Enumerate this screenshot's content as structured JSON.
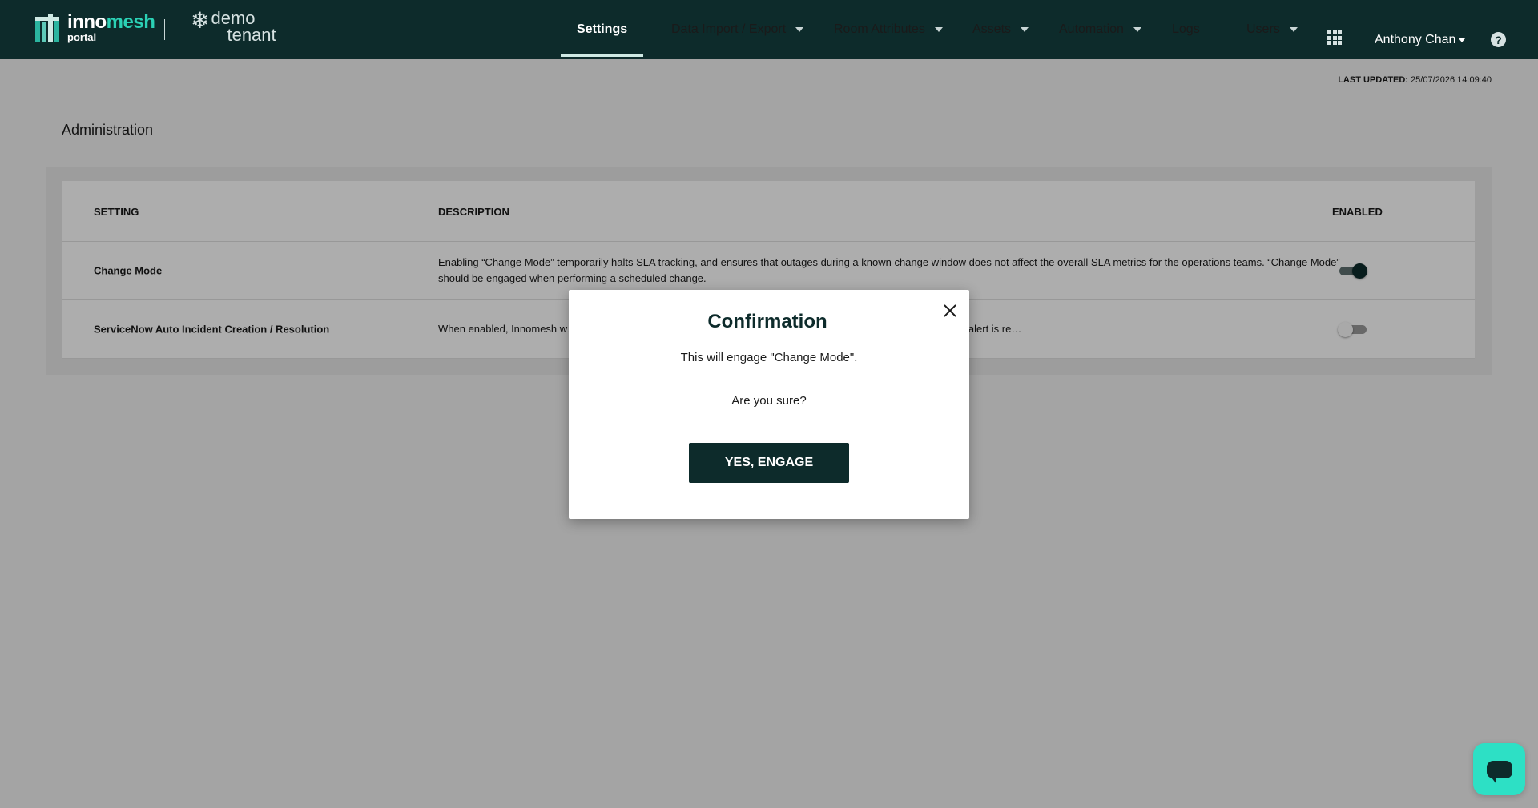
{
  "brand": {
    "name_part1": "inno",
    "name_part2": "mesh",
    "sub": "portal",
    "tenant_line1": "demo",
    "tenant_line2": "tenant"
  },
  "nav": {
    "items": [
      {
        "label": "Settings",
        "active": true
      },
      {
        "label": "Data Import / Export",
        "dropdown": true
      },
      {
        "label": "Room Attributes",
        "dropdown": true
      },
      {
        "label": "Assets",
        "dropdown": true
      },
      {
        "label": "Automation",
        "dropdown": true
      },
      {
        "label": "Logs"
      },
      {
        "label": "Users",
        "dropdown": true
      }
    ],
    "user": "Anthony Chan",
    "help": "?"
  },
  "status": {
    "last_updated_label": "LAST UPDATED",
    "last_updated_value": "25/07/2026 14:09:40"
  },
  "page": {
    "title": "Administration"
  },
  "table": {
    "headers": {
      "setting": "SETTING",
      "description": "DESCRIPTION",
      "enabled": "ENABLED"
    },
    "rows": [
      {
        "setting": "Change Mode",
        "description": "Enabling “Change Mode” temporarily halts SLA tracking, and ensures that outages during a known change window does not affect the overall SLA metrics for the operations teams. “Change Mode” should be engaged when performing a scheduled change.",
        "enabled": true
      },
      {
        "setting": "ServiceNow Auto Incident Creation / Resolution",
        "description": "When enabled, Innomesh w… created, and will automatically resolve the ServiceNow incident 15 minutes after the alert is re…",
        "enabled": false
      }
    ]
  },
  "modal": {
    "title": "Confirmation",
    "message": "This will engage \"Change Mode\".",
    "question": "Are you sure?",
    "confirm_label": "YES, ENGAGE"
  },
  "colors": {
    "nav_bg": "#0d2b2b",
    "accent": "#2bd1b5",
    "chat": "#2de0c5"
  }
}
